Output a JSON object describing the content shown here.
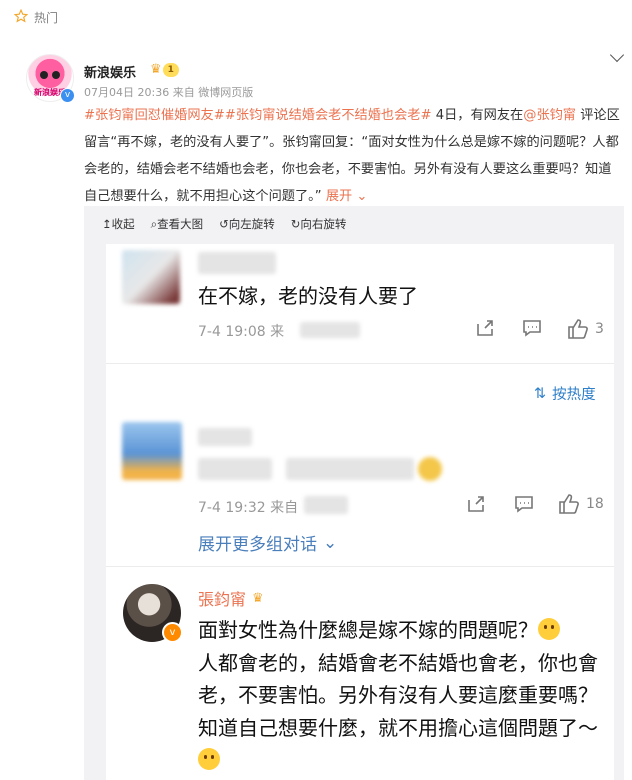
{
  "hot": {
    "icon": "star-icon",
    "label": "热门"
  },
  "post": {
    "author": "新浪娱乐",
    "level": "1",
    "avatar_text": "新浪娱乐",
    "time": "07月04日 20:36",
    "source": "来自 微博网页版",
    "tag1": "#张钧甯回怼催婚网友#",
    "tag2": "#张钧甯说结婚会老不结婚也会老#",
    "text_a": " 4日，有网友在",
    "mention": "@张钧甯",
    "text_b": " 评论区留言“再不嫁，老的没有人要了”。张钧甯回复：“面对女性为什么总是嫁不嫁的问题呢？人都会老的，结婚会老不结婚也会老，你也会老，不要害怕。另外有没有人要这么重要吗？知道自己想要什么，就不用担心这个问题了。”",
    "unfold": "展开"
  },
  "toolbar": {
    "collapse": "收起",
    "view_large": "查看大图",
    "rotate_left": "向左旋转",
    "rotate_right": "向右旋转"
  },
  "comment1": {
    "text": "在不嫁，老的没有人要了",
    "time": "7-4 19:08",
    "from": "来",
    "likes": "3"
  },
  "sort_label": "按热度",
  "comment2": {
    "time": "7-4 19:32",
    "from": "来自",
    "likes": "18"
  },
  "more_replies": "展开更多组对话",
  "reply": {
    "name": "張鈞甯",
    "text": "面對女性為什麼總是嫁不嫁的問題呢？",
    "text2": "人都會老的，結婚會老不結婚也會老，你也會老，不要害怕。另外有沒有人要這麼重要嗎？知道自己想要什麼，就不用擔心這個問題了～"
  },
  "colors": {
    "accent": "#eb7350",
    "link": "#2e7fc9",
    "panel": "#f2f2f5"
  }
}
